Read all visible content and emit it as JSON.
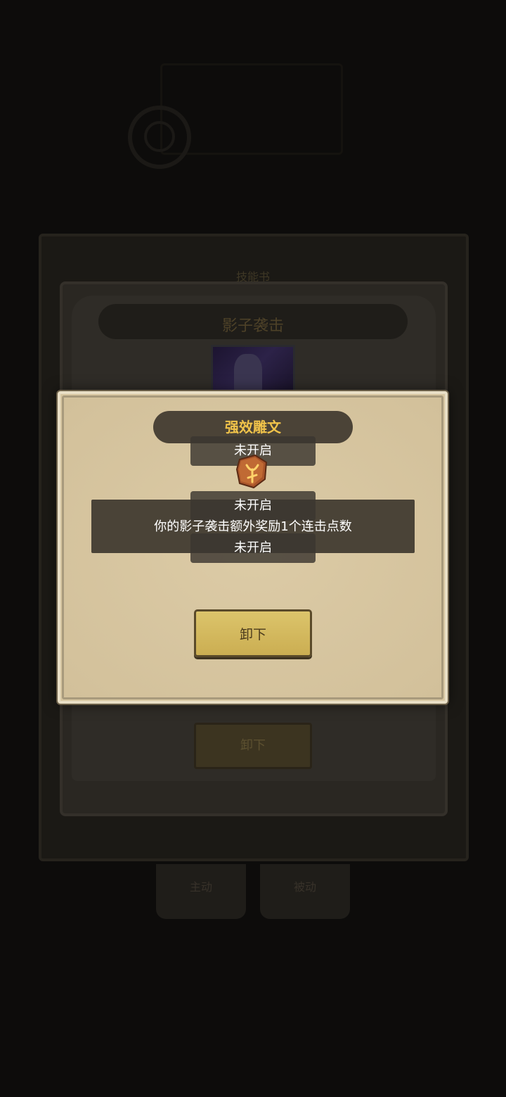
{
  "background": {
    "panel_title": "技能书",
    "skill_name": "影子袭击",
    "unequip_label": "卸下",
    "tabs": [
      "主动",
      "被动"
    ]
  },
  "modal": {
    "title": "强效雕文",
    "description": "你的影子袭击额外奖励1个连击点数",
    "unequip_label": "卸下",
    "tooltips": [
      "未开启",
      "未开启",
      "未开启"
    ],
    "icons": {
      "rune": "rune-glyph-icon",
      "skill": "shadow-strike-icon"
    }
  },
  "colors": {
    "title": "#f0c34a",
    "parchment": "#d7c6a1",
    "button": "#d4b95f",
    "banner": "#4b4337"
  }
}
